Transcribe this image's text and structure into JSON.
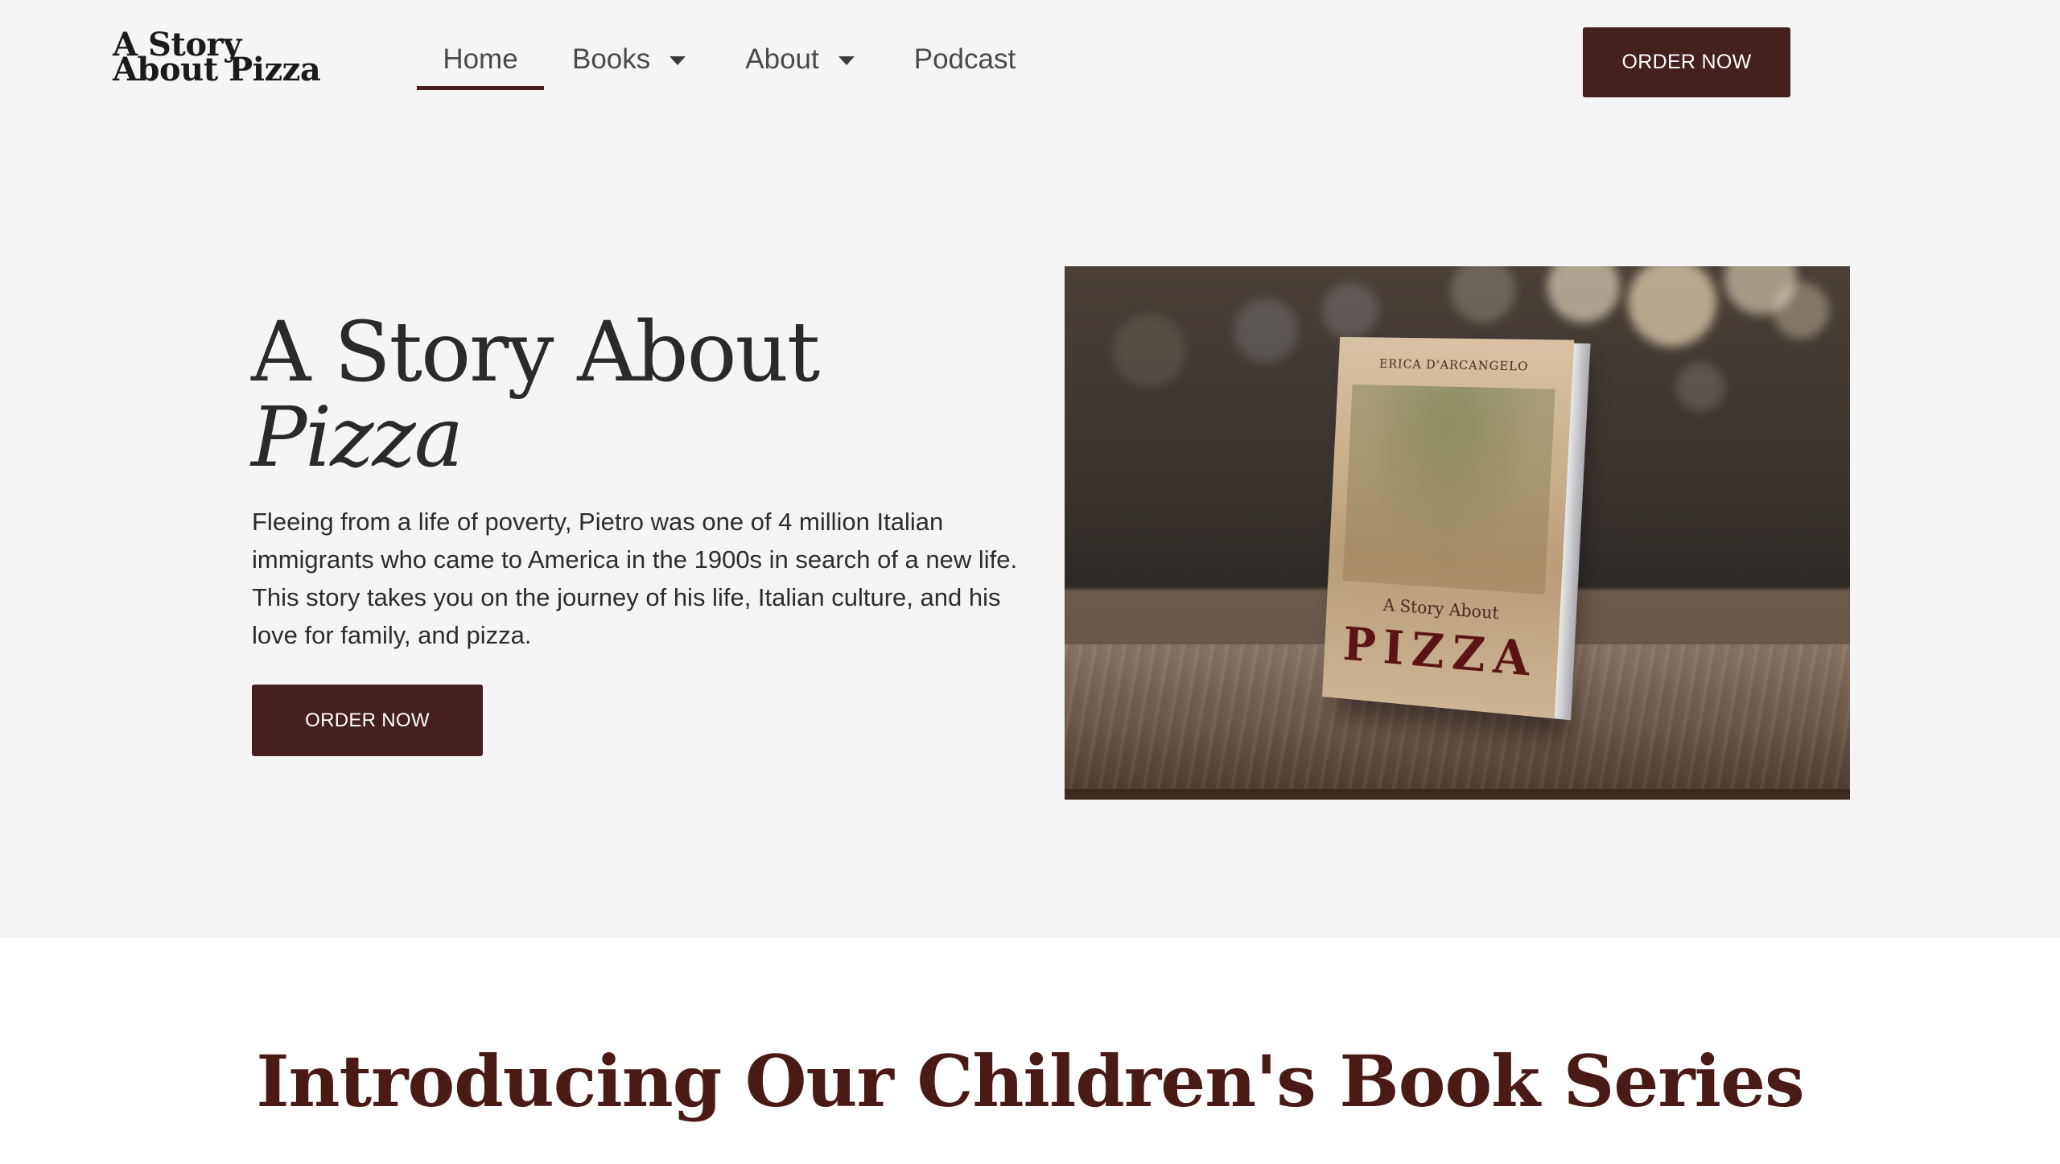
{
  "header": {
    "logo_line1": "A Story",
    "logo_line2": "About Pizza",
    "nav": {
      "home": "Home",
      "books": "Books",
      "about": "About",
      "podcast": "Podcast"
    },
    "order_button": "ORDER NOW"
  },
  "hero": {
    "title_line1": "A Story About",
    "title_line2": "Pizza",
    "description": "Fleeing from a life of poverty, Pietro was one of 4 million Italian immigrants who came to America in the 1900s in search of a new life. This story takes you on the journey of his life, Italian culture, and his love for family, and pizza.",
    "order_button": "ORDER NOW",
    "book_cover": {
      "author": "ERICA D'ARCANGELO",
      "subtitle": "A Story About",
      "title": "PIZZA"
    }
  },
  "section2": {
    "title": "Introducing Our Children's Book Series"
  },
  "colors": {
    "brand": "#45201f",
    "accent_underline": "#4a1f1f",
    "heading_dark_red": "#4a1a17",
    "background": "#f5f5f5"
  },
  "icons": {
    "dropdown": "chevron-down-icon"
  }
}
